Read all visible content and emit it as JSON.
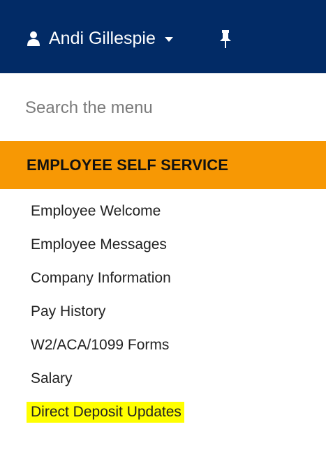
{
  "header": {
    "user_name": "Andi Gillespie",
    "user_icon": "user-icon",
    "dropdown_icon": "caret-down-icon",
    "pin_icon": "pin-icon",
    "background_color": "#022b66"
  },
  "search": {
    "placeholder": "Search the menu",
    "value": ""
  },
  "section": {
    "title": "EMPLOYEE SELF SERVICE",
    "background_color": "#f79804"
  },
  "menu": {
    "items": [
      {
        "label": "Employee Welcome",
        "highlighted": false
      },
      {
        "label": "Employee Messages",
        "highlighted": false
      },
      {
        "label": "Company Information",
        "highlighted": false
      },
      {
        "label": "Pay History",
        "highlighted": false
      },
      {
        "label": "W2/ACA/1099 Forms",
        "highlighted": false
      },
      {
        "label": "Salary",
        "highlighted": false
      },
      {
        "label": "Direct Deposit Updates",
        "highlighted": true
      }
    ],
    "highlight_color": "#ffff00"
  }
}
